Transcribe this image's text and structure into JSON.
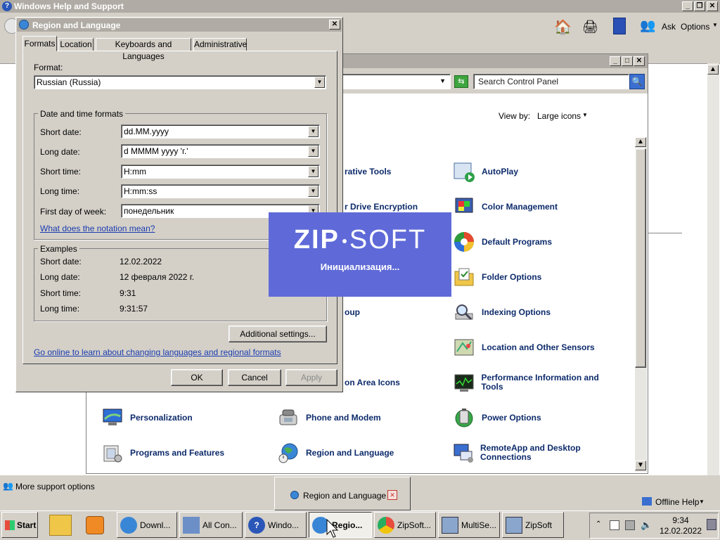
{
  "help_window": {
    "title": "Windows Help and Support",
    "ask_label": "Ask",
    "options_label": "Options",
    "more_support": "More support options",
    "offline_help": "Offline Help"
  },
  "control_panel": {
    "search_placeholder": "Search Control Panel",
    "view_by_label": "View by:",
    "view_by_value": "Large icons",
    "items": [
      {
        "label": "AutoPlay",
        "icon": "autoplay-icon"
      },
      {
        "label": "Color Management",
        "icon": "color-management-icon"
      },
      {
        "label": "Default Programs",
        "icon": "default-programs-icon"
      },
      {
        "label": "Folder Options",
        "icon": "folder-options-icon"
      },
      {
        "label": "Indexing Options",
        "icon": "indexing-options-icon"
      },
      {
        "label": "Location and Other Sensors",
        "icon": "location-sensors-icon"
      },
      {
        "label": "Performance Information and Tools",
        "icon": "performance-icon"
      },
      {
        "label": "Power Options",
        "icon": "power-options-icon"
      },
      {
        "label": "RemoteApp and Desktop Connections",
        "icon": "remoteapp-icon"
      },
      {
        "label": "Personalization",
        "icon": "personalization-icon"
      },
      {
        "label": "Programs and Features",
        "icon": "programs-features-icon"
      },
      {
        "label": "Phone and Modem",
        "icon": "phone-modem-icon"
      },
      {
        "label": "Region and Language",
        "icon": "region-language-icon"
      }
    ],
    "partial_items": [
      "rative Tools",
      "r Drive Encryption",
      "oup",
      "on Area Icons"
    ]
  },
  "region_dialog": {
    "title": "Region and Language",
    "tabs": [
      "Formats",
      "Location",
      "Keyboards and Languages",
      "Administrative"
    ],
    "format_label": "Format:",
    "format_value": "Russian (Russia)",
    "dt_group_label": "Date and time formats",
    "short_date_label": "Short date:",
    "short_date_value": "dd.MM.yyyy",
    "long_date_label": "Long date:",
    "long_date_value": "d MMMM yyyy 'г.'",
    "short_time_label": "Short time:",
    "short_time_value": "H:mm",
    "long_time_label": "Long time:",
    "long_time_value": "H:mm:ss",
    "first_day_label": "First day of week:",
    "first_day_value": "понедельник",
    "notation_link": "What does the notation mean?",
    "examples_label": "Examples",
    "ex_short_date_label": "Short date:",
    "ex_short_date": "12.02.2022",
    "ex_long_date_label": "Long date:",
    "ex_long_date": "12 февраля 2022 г.",
    "ex_short_time_label": "Short time:",
    "ex_short_time": "9:31",
    "ex_long_time_label": "Long time:",
    "ex_long_time": "9:31:57",
    "additional_settings": "Additional settings...",
    "online_link": "Go online to learn about changing languages and regional formats",
    "ok": "OK",
    "cancel": "Cancel",
    "apply": "Apply"
  },
  "splash": {
    "logo_left": "ZIP",
    "logo_right": "SOFT",
    "status": "Инициализация..."
  },
  "taskbar_preview": {
    "label": "Region and Language"
  },
  "taskbar": {
    "start": "Start",
    "buttons": [
      "Downl...",
      "All Con...",
      "Windo...",
      "Regio...",
      "ZipSoft...",
      "MultiSe...",
      "ZipSoft"
    ],
    "clock_time": "9:34",
    "clock_date": "12.02.2022"
  },
  "colors": {
    "splash_bg": "#5f6ad8",
    "title_inactive": "#b0aca5",
    "cp_text": "#0d2b6b",
    "link": "#1a3cb0"
  }
}
